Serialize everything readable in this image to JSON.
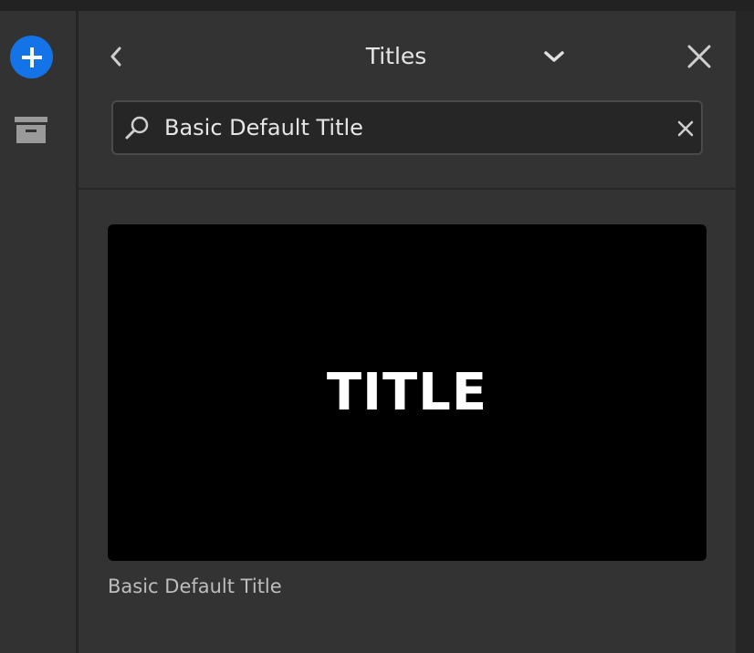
{
  "header": {
    "title": "Titles",
    "back_icon": "chevron-left-icon",
    "dropdown_icon": "chevron-down-icon",
    "close_icon": "close-icon"
  },
  "rail": {
    "add_icon": "plus-icon",
    "archive_icon": "archive-icon",
    "add_color": "#1473e6"
  },
  "search": {
    "value": "Basic Default Title",
    "icon": "search-icon",
    "clear_icon": "clear-icon"
  },
  "results": [
    {
      "thumbnail_text": "TITLE",
      "label": "Basic Default Title"
    }
  ]
}
